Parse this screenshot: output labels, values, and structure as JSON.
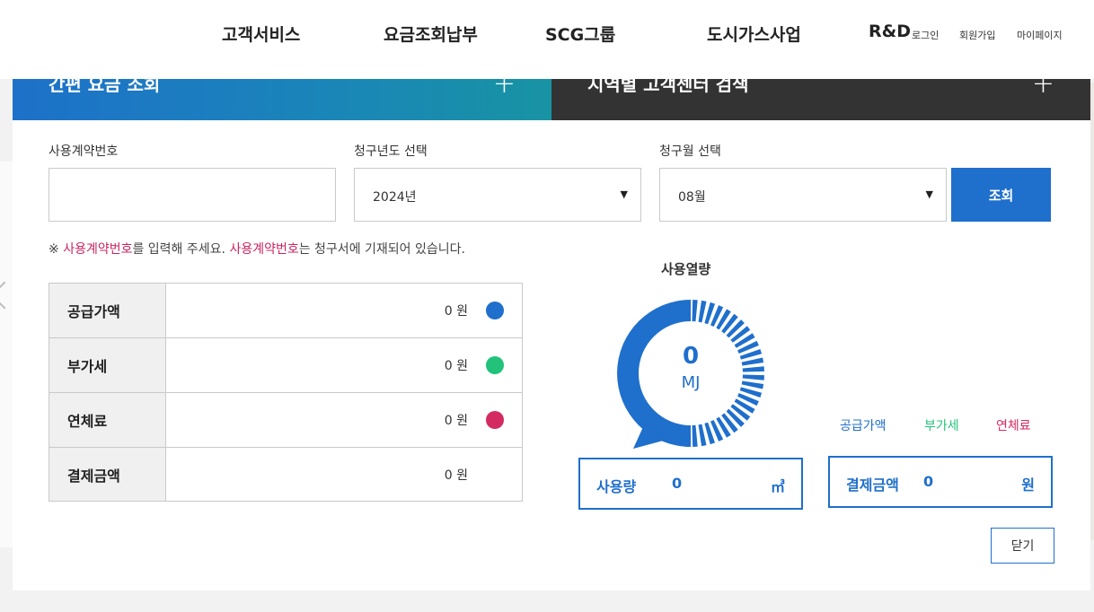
{
  "nav": {
    "items": [
      "고객서비스",
      "요금조회납부",
      "SCG그룹",
      "도시가스사업",
      "R&D"
    ],
    "util": [
      "로그인",
      "회원가입",
      "마이페이지"
    ]
  },
  "tabs": {
    "left_title": "간편 요금 조회",
    "right_title": "지역별 고객센터 검색",
    "plus": "+"
  },
  "form": {
    "contract_label": "사용계약번호",
    "contract_value": "",
    "year_label": "청구년도 선택",
    "year_value": "2024년",
    "month_label": "청구월 선택",
    "month_value": "08월",
    "arrow": "▼",
    "search_label": "조회"
  },
  "notice": {
    "prefix": "※ ",
    "hl1": "사용계약번호",
    "mid": "를 입력해 주세요. ",
    "hl2": "사용계약번호",
    "suffix": "는 청구서에 기재되어 있습니다."
  },
  "fees": [
    {
      "label": "공급가액",
      "amount": "0 원",
      "color": "#1f6fcc"
    },
    {
      "label": "부가세",
      "amount": "0 원",
      "color": "#22c27a"
    },
    {
      "label": "연체료",
      "amount": "0 원",
      "color": "#d42a62"
    },
    {
      "label": "결제금액",
      "amount": "0 원",
      "color": ""
    }
  ],
  "chart": {
    "title": "사용열량",
    "value": "0",
    "unit": "MJ",
    "legend": [
      {
        "label": "공급가액",
        "color": "#1f6fcc"
      },
      {
        "label": "부가세",
        "color": "#22c27a"
      },
      {
        "label": "연체료",
        "color": "#d42a62"
      }
    ]
  },
  "summary": {
    "usage_label": "사용량",
    "usage_value": "0",
    "usage_unit": "㎥",
    "pay_label": "결제금액",
    "pay_value": "0",
    "pay_unit": "원"
  },
  "close_label": "닫기"
}
